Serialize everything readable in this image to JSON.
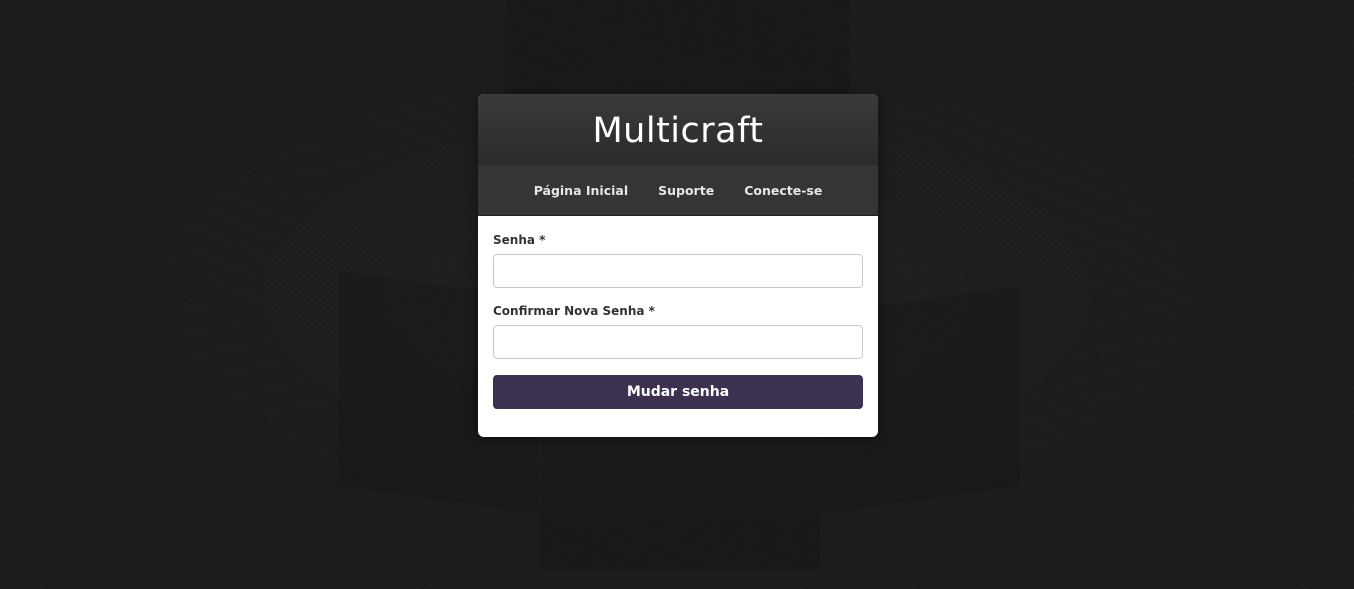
{
  "header": {
    "title": "Multicraft"
  },
  "nav": {
    "items": [
      {
        "label": "Página Inicial"
      },
      {
        "label": "Suporte"
      },
      {
        "label": "Conecte-se"
      }
    ]
  },
  "form": {
    "password_label": "Senha *",
    "password_value": "",
    "confirm_label": "Confirmar Nova Senha *",
    "confirm_value": "",
    "submit_label": "Mudar senha"
  },
  "colors": {
    "background": "#1c1c1e",
    "header": "#2f2f2f",
    "nav": "#353535",
    "button": "#3c3250"
  }
}
